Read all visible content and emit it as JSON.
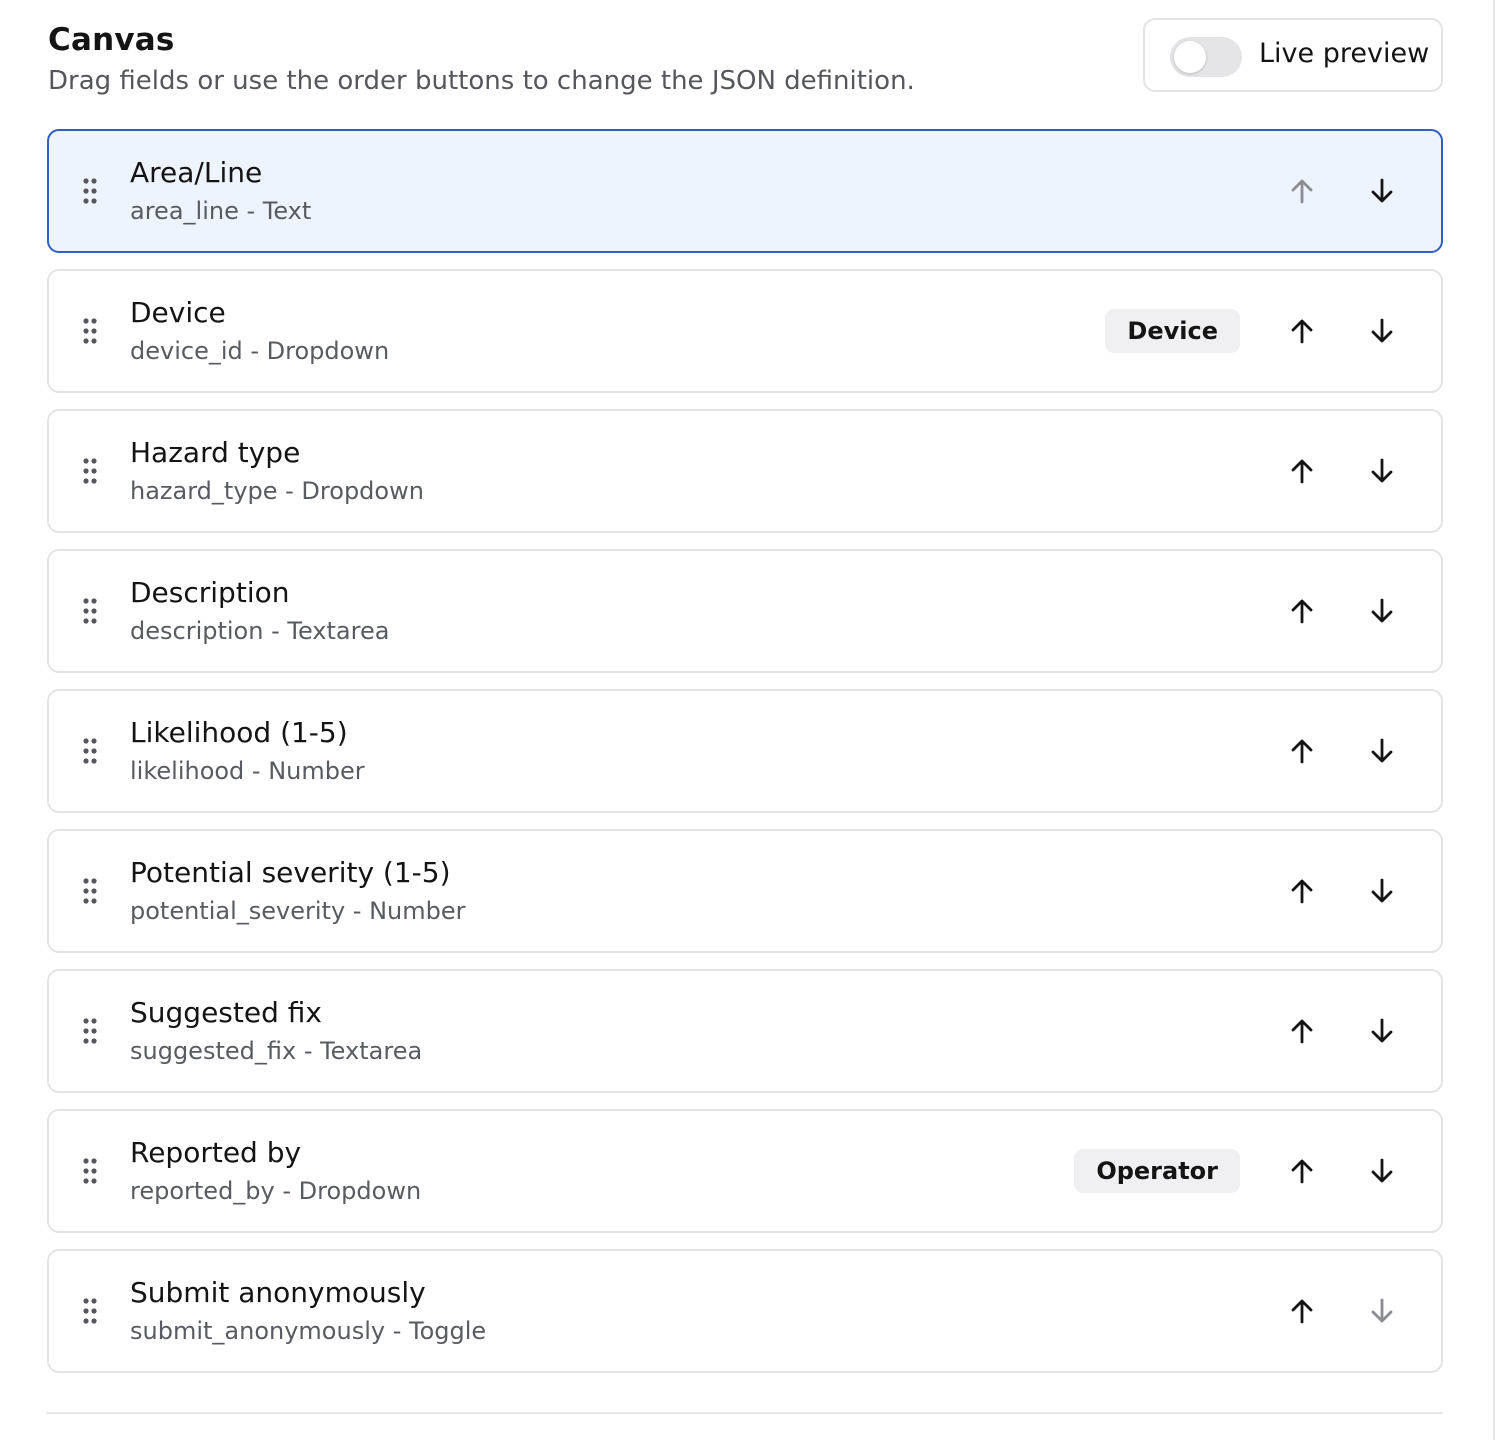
{
  "canvas": {
    "title": "Canvas",
    "subtitle": "Drag fields or use the order buttons to change the JSON definition.",
    "live_preview": {
      "label": "Live preview",
      "enabled": false
    }
  },
  "fields": [
    {
      "label": "Area/Line",
      "meta": "area_line - Text",
      "badge": null,
      "selected": true,
      "up_enabled": false,
      "down_enabled": true
    },
    {
      "label": "Device",
      "meta": "device_id - Dropdown",
      "badge": "Device",
      "selected": false,
      "up_enabled": true,
      "down_enabled": true
    },
    {
      "label": "Hazard type",
      "meta": "hazard_type - Dropdown",
      "badge": null,
      "selected": false,
      "up_enabled": true,
      "down_enabled": true
    },
    {
      "label": "Description",
      "meta": "description - Textarea",
      "badge": null,
      "selected": false,
      "up_enabled": true,
      "down_enabled": true
    },
    {
      "label": "Likelihood (1-5)",
      "meta": "likelihood - Number",
      "badge": null,
      "selected": false,
      "up_enabled": true,
      "down_enabled": true
    },
    {
      "label": "Potential severity (1-5)",
      "meta": "potential_severity - Number",
      "badge": null,
      "selected": false,
      "up_enabled": true,
      "down_enabled": true
    },
    {
      "label": "Suggested fix",
      "meta": "suggested_fix - Textarea",
      "badge": null,
      "selected": false,
      "up_enabled": true,
      "down_enabled": true
    },
    {
      "label": "Reported by",
      "meta": "reported_by - Dropdown",
      "badge": "Operator",
      "selected": false,
      "up_enabled": true,
      "down_enabled": true
    },
    {
      "label": "Submit anonymously",
      "meta": "submit_anonymously - Toggle",
      "badge": null,
      "selected": false,
      "up_enabled": true,
      "down_enabled": false
    }
  ],
  "icons": {
    "grip": "drag-handle-icon",
    "move_up": "arrow-up-icon",
    "move_down": "arrow-down-icon"
  },
  "colors": {
    "selected_border": "#2f5fc2",
    "selected_background": "#eef4fd",
    "card_border": "#e4e4e7",
    "arrow_enabled": "#141414",
    "arrow_disabled": "#8a8c91",
    "badge_background": "#f0f0f2"
  }
}
